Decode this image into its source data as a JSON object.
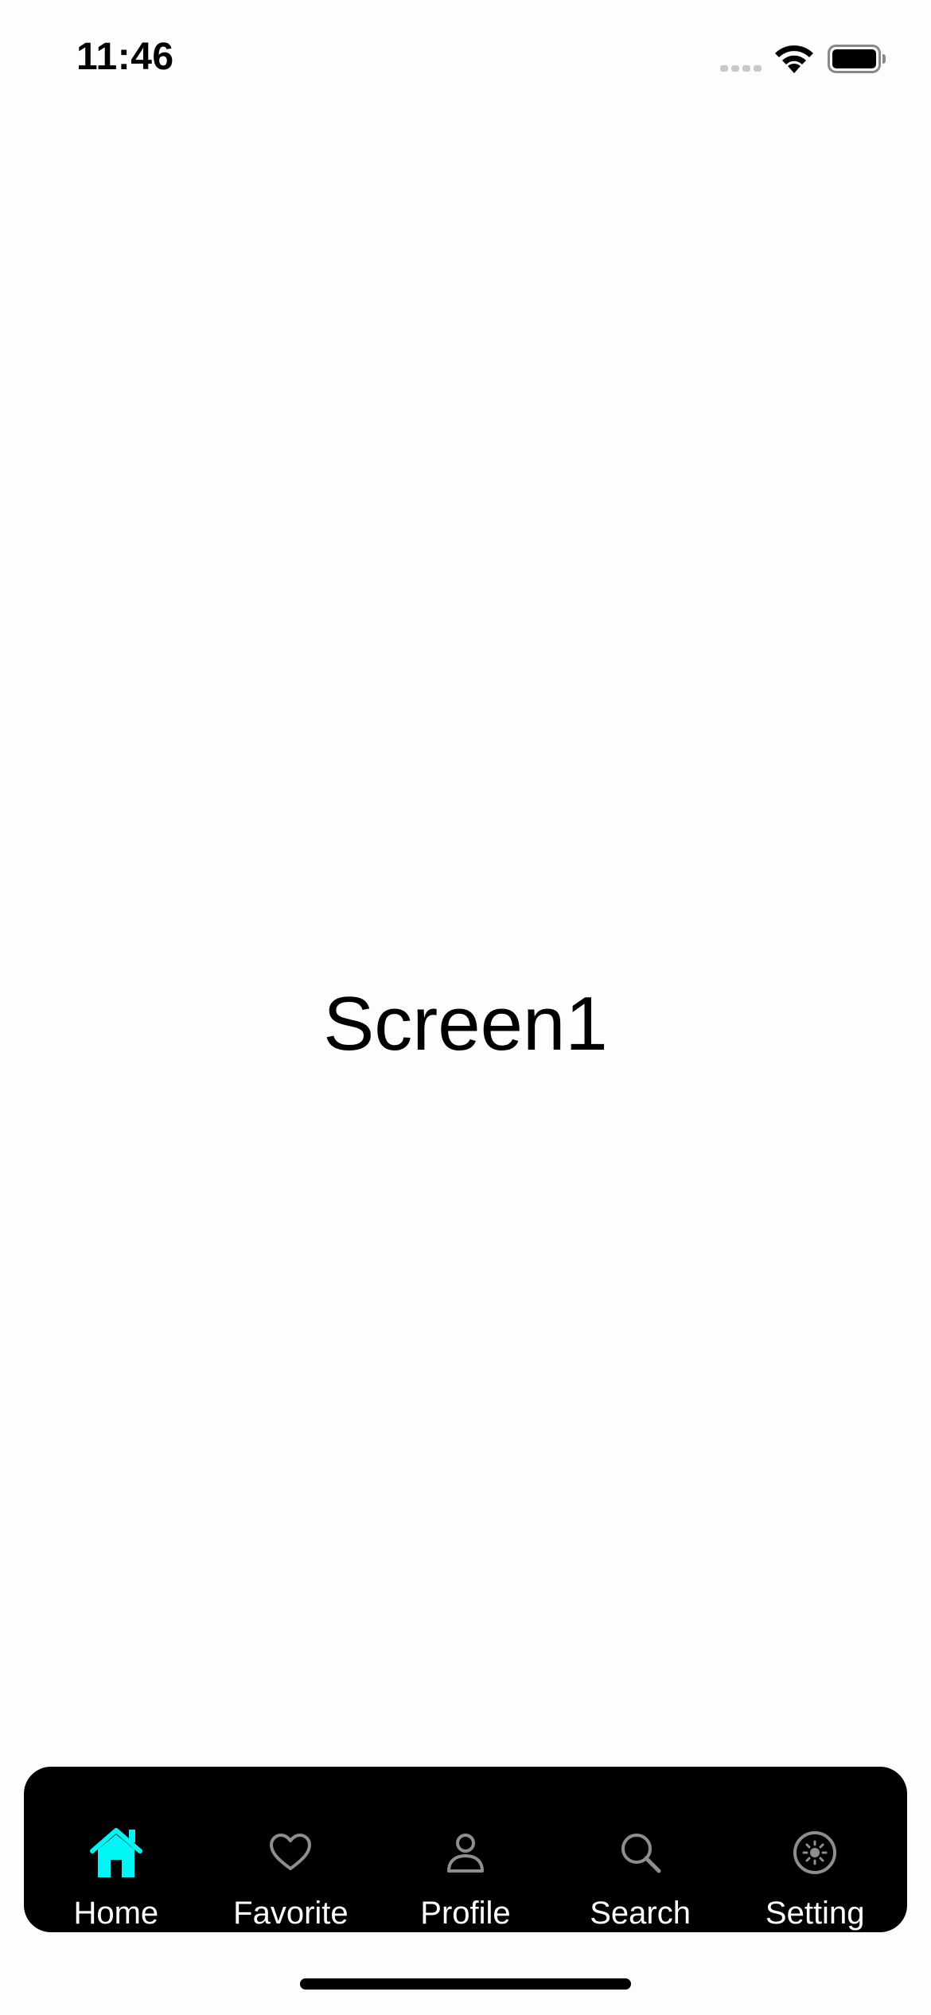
{
  "status_bar": {
    "time": "11:46"
  },
  "main": {
    "title": "Screen1"
  },
  "tab_bar": {
    "active_color": "#00f5f5",
    "inactive_color": "#8e8e8e",
    "items": [
      {
        "label": "Home",
        "icon": "home-icon",
        "active": true
      },
      {
        "label": "Favorite",
        "icon": "heart-icon",
        "active": false
      },
      {
        "label": "Profile",
        "icon": "person-icon",
        "active": false
      },
      {
        "label": "Search",
        "icon": "search-icon",
        "active": false
      },
      {
        "label": "Setting",
        "icon": "sun-icon",
        "active": false
      }
    ]
  }
}
